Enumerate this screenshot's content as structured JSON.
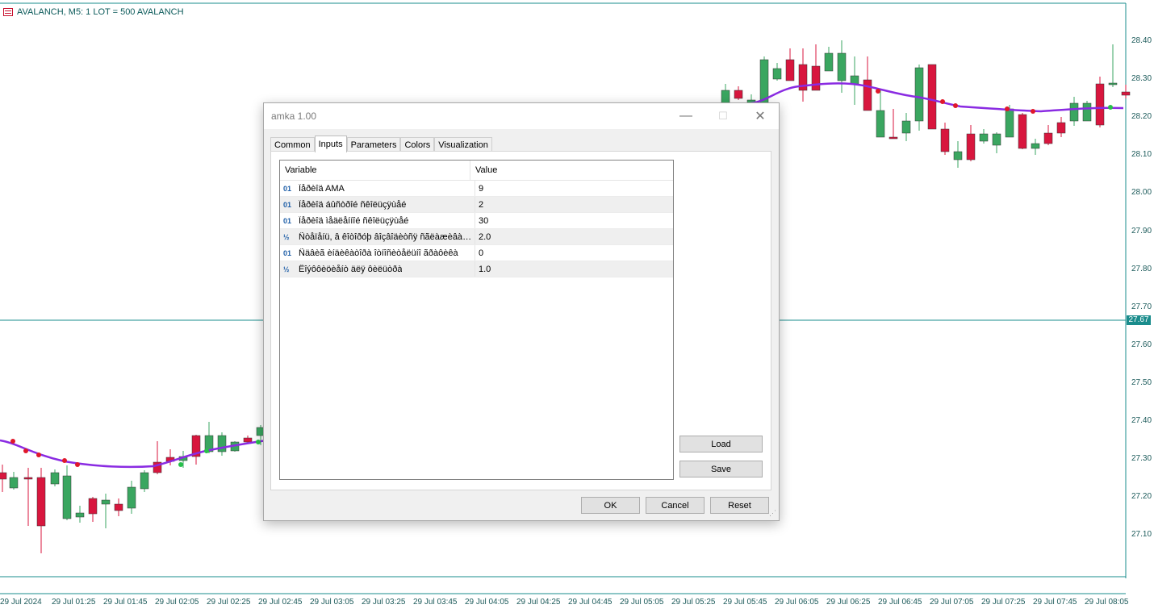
{
  "chart": {
    "title": "AVALANCH, M5:  1 LOT = 500 AVALANCH",
    "price_labels": [
      "28.40",
      "28.30",
      "28.20",
      "28.10",
      "28.00",
      "27.90",
      "27.80",
      "27.70",
      "27.60",
      "27.50",
      "27.40",
      "27.30",
      "27.20",
      "27.10"
    ],
    "current_price": "27.67",
    "time_labels": [
      "29 Jul 2024",
      "29 Jul 01:25",
      "29 Jul 01:45",
      "29 Jul 02:05",
      "29 Jul 02:25",
      "29 Jul 02:45",
      "29 Jul 03:05",
      "29 Jul 03:25",
      "29 Jul 03:45",
      "29 Jul 04:05",
      "29 Jul 04:25",
      "29 Jul 04:45",
      "29 Jul 05:05",
      "29 Jul 05:25",
      "29 Jul 05:45",
      "29 Jul 06:05",
      "29 Jul 06:25",
      "29 Jul 06:45",
      "29 Jul 07:05",
      "29 Jul 07:25",
      "29 Jul 07:45",
      "29 Jul 08:05"
    ],
    "colors": {
      "bull": "#3aa660",
      "bear": "#d8163e",
      "ama": "#8a2be2",
      "grid_line": "#1a8c8c"
    }
  },
  "dialog": {
    "title": "amka 1.00",
    "controls": {
      "minimize": "—",
      "maximize": "☐",
      "close": "✕"
    },
    "tabs": [
      {
        "label": "Common"
      },
      {
        "label": "Inputs"
      },
      {
        "label": "Parameters"
      },
      {
        "label": "Colors"
      },
      {
        "label": "Visualization"
      }
    ],
    "active_tab": "Inputs",
    "grid": {
      "col_variable": "Variable",
      "col_value": "Value",
      "rows": [
        {
          "icon": "01",
          "variable": "Ïåðèîä AMA",
          "value": "9"
        },
        {
          "icon": "01",
          "variable": "Ïåðèîä áûñòðîé ñêîëüçÿùåé",
          "value": "2"
        },
        {
          "icon": "01",
          "variable": "Ïåðèîä ìåäëåííîé ñêîëüçÿùåé",
          "value": "30"
        },
        {
          "icon": "½",
          "variable": "Ñòåïåíü, â êîòîðóþ âîçâîäèòñÿ ñãëàæèâàþ...",
          "value": "2.0"
        },
        {
          "icon": "01",
          "variable": "Ñäâèã èíäèêàòîðà îòíîñèòåëüíî ãðàôèêà",
          "value": "0"
        },
        {
          "icon": "½",
          "variable": "Êîýôôèöèåíò äëÿ ôèëüòðà",
          "value": "1.0"
        }
      ]
    },
    "buttons": {
      "load": "Load",
      "save": "Save",
      "ok": "OK",
      "cancel": "Cancel",
      "reset": "Reset"
    }
  }
}
